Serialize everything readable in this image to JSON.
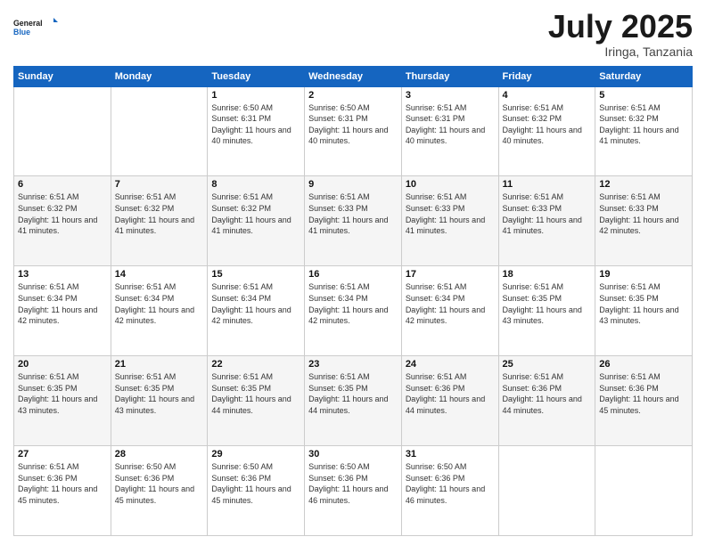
{
  "header": {
    "logo_line1": "General",
    "logo_line2": "Blue",
    "month": "July 2025",
    "location": "Iringa, Tanzania"
  },
  "days_of_week": [
    "Sunday",
    "Monday",
    "Tuesday",
    "Wednesday",
    "Thursday",
    "Friday",
    "Saturday"
  ],
  "weeks": [
    [
      {
        "day": "",
        "info": ""
      },
      {
        "day": "",
        "info": ""
      },
      {
        "day": "1",
        "info": "Sunrise: 6:50 AM\nSunset: 6:31 PM\nDaylight: 11 hours and 40 minutes."
      },
      {
        "day": "2",
        "info": "Sunrise: 6:50 AM\nSunset: 6:31 PM\nDaylight: 11 hours and 40 minutes."
      },
      {
        "day": "3",
        "info": "Sunrise: 6:51 AM\nSunset: 6:31 PM\nDaylight: 11 hours and 40 minutes."
      },
      {
        "day": "4",
        "info": "Sunrise: 6:51 AM\nSunset: 6:32 PM\nDaylight: 11 hours and 40 minutes."
      },
      {
        "day": "5",
        "info": "Sunrise: 6:51 AM\nSunset: 6:32 PM\nDaylight: 11 hours and 41 minutes."
      }
    ],
    [
      {
        "day": "6",
        "info": "Sunrise: 6:51 AM\nSunset: 6:32 PM\nDaylight: 11 hours and 41 minutes."
      },
      {
        "day": "7",
        "info": "Sunrise: 6:51 AM\nSunset: 6:32 PM\nDaylight: 11 hours and 41 minutes."
      },
      {
        "day": "8",
        "info": "Sunrise: 6:51 AM\nSunset: 6:32 PM\nDaylight: 11 hours and 41 minutes."
      },
      {
        "day": "9",
        "info": "Sunrise: 6:51 AM\nSunset: 6:33 PM\nDaylight: 11 hours and 41 minutes."
      },
      {
        "day": "10",
        "info": "Sunrise: 6:51 AM\nSunset: 6:33 PM\nDaylight: 11 hours and 41 minutes."
      },
      {
        "day": "11",
        "info": "Sunrise: 6:51 AM\nSunset: 6:33 PM\nDaylight: 11 hours and 41 minutes."
      },
      {
        "day": "12",
        "info": "Sunrise: 6:51 AM\nSunset: 6:33 PM\nDaylight: 11 hours and 42 minutes."
      }
    ],
    [
      {
        "day": "13",
        "info": "Sunrise: 6:51 AM\nSunset: 6:34 PM\nDaylight: 11 hours and 42 minutes."
      },
      {
        "day": "14",
        "info": "Sunrise: 6:51 AM\nSunset: 6:34 PM\nDaylight: 11 hours and 42 minutes."
      },
      {
        "day": "15",
        "info": "Sunrise: 6:51 AM\nSunset: 6:34 PM\nDaylight: 11 hours and 42 minutes."
      },
      {
        "day": "16",
        "info": "Sunrise: 6:51 AM\nSunset: 6:34 PM\nDaylight: 11 hours and 42 minutes."
      },
      {
        "day": "17",
        "info": "Sunrise: 6:51 AM\nSunset: 6:34 PM\nDaylight: 11 hours and 42 minutes."
      },
      {
        "day": "18",
        "info": "Sunrise: 6:51 AM\nSunset: 6:35 PM\nDaylight: 11 hours and 43 minutes."
      },
      {
        "day": "19",
        "info": "Sunrise: 6:51 AM\nSunset: 6:35 PM\nDaylight: 11 hours and 43 minutes."
      }
    ],
    [
      {
        "day": "20",
        "info": "Sunrise: 6:51 AM\nSunset: 6:35 PM\nDaylight: 11 hours and 43 minutes."
      },
      {
        "day": "21",
        "info": "Sunrise: 6:51 AM\nSunset: 6:35 PM\nDaylight: 11 hours and 43 minutes."
      },
      {
        "day": "22",
        "info": "Sunrise: 6:51 AM\nSunset: 6:35 PM\nDaylight: 11 hours and 44 minutes."
      },
      {
        "day": "23",
        "info": "Sunrise: 6:51 AM\nSunset: 6:35 PM\nDaylight: 11 hours and 44 minutes."
      },
      {
        "day": "24",
        "info": "Sunrise: 6:51 AM\nSunset: 6:36 PM\nDaylight: 11 hours and 44 minutes."
      },
      {
        "day": "25",
        "info": "Sunrise: 6:51 AM\nSunset: 6:36 PM\nDaylight: 11 hours and 44 minutes."
      },
      {
        "day": "26",
        "info": "Sunrise: 6:51 AM\nSunset: 6:36 PM\nDaylight: 11 hours and 45 minutes."
      }
    ],
    [
      {
        "day": "27",
        "info": "Sunrise: 6:51 AM\nSunset: 6:36 PM\nDaylight: 11 hours and 45 minutes."
      },
      {
        "day": "28",
        "info": "Sunrise: 6:50 AM\nSunset: 6:36 PM\nDaylight: 11 hours and 45 minutes."
      },
      {
        "day": "29",
        "info": "Sunrise: 6:50 AM\nSunset: 6:36 PM\nDaylight: 11 hours and 45 minutes."
      },
      {
        "day": "30",
        "info": "Sunrise: 6:50 AM\nSunset: 6:36 PM\nDaylight: 11 hours and 46 minutes."
      },
      {
        "day": "31",
        "info": "Sunrise: 6:50 AM\nSunset: 6:36 PM\nDaylight: 11 hours and 46 minutes."
      },
      {
        "day": "",
        "info": ""
      },
      {
        "day": "",
        "info": ""
      }
    ]
  ]
}
